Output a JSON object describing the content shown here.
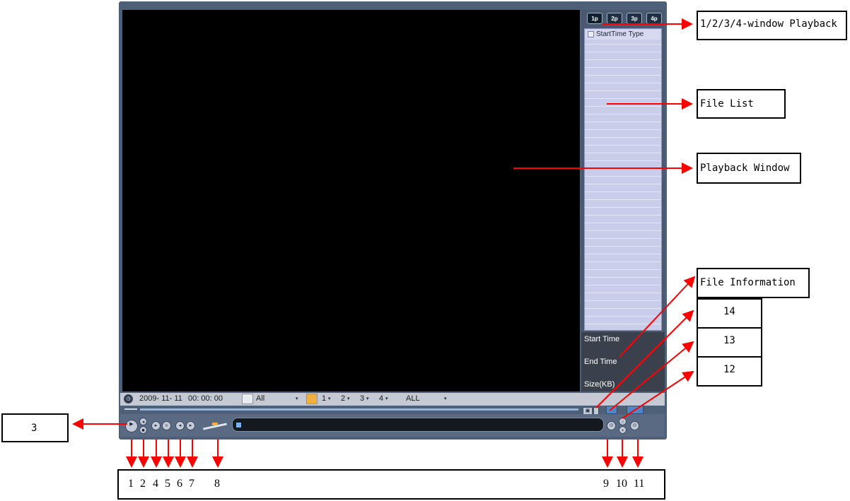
{
  "window_tabs": [
    "1p",
    "2p",
    "3p",
    "4p"
  ],
  "file_list": {
    "header": "StartTime Type"
  },
  "file_info": {
    "start_time": "Start Time",
    "end_time": "End Time",
    "size": "Size(KB)"
  },
  "filter_bar": {
    "date": "2009- 11- 11",
    "time": "00: 00: 00",
    "record_type": "All",
    "channels": [
      "1",
      "2",
      "3",
      "4"
    ],
    "mode": "ALL"
  },
  "annotations": {
    "window_playback": "1/2/3/4-window Playback",
    "file_list": "File List",
    "playback_window": "Playback Window",
    "file_information": "File Information",
    "callout_14": "14",
    "callout_13": "13",
    "callout_12": "12",
    "callout_3": "3",
    "bottom_numbers": [
      "1",
      "2",
      "4",
      "5",
      "6",
      "7",
      "8",
      "9",
      "10",
      "11"
    ]
  },
  "colors": {
    "arrow": "#ff0000",
    "window_frame": "#4e6078",
    "file_list_bg": "#c9cdea"
  }
}
